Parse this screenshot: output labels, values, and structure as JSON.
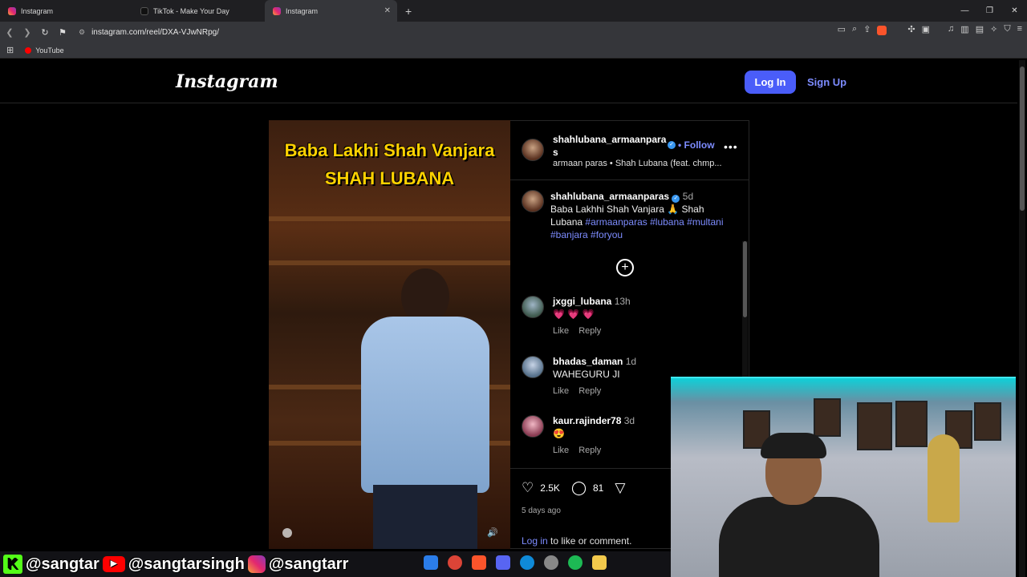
{
  "browser": {
    "tabs": [
      {
        "label": "Instagram",
        "icon": "instagram-icon"
      },
      {
        "label": "TikTok - Make Your Day",
        "icon": "tiktok-icon"
      },
      {
        "label": "Instagram",
        "icon": "instagram-icon"
      }
    ],
    "url": "instagram.com/reel/DXA-VJwNRpg/",
    "bookmark": "YouTube"
  },
  "header": {
    "logo": "Instagram",
    "login": "Log In",
    "signup": "Sign Up"
  },
  "video": {
    "caption_line1": "Baba Lakhi Shah Vanjara",
    "caption_line2": "SHAH LUBANA"
  },
  "post": {
    "username": "shahlubana_armaanparas",
    "follow": "Follow",
    "subline": "armaan paras • Shah Lubana (feat. chmp...",
    "caption_user": "shahlubana_armaanparas",
    "caption_time": "5d",
    "caption_text": "Baba Lakhhi Shah Vanjara 🙏 Shah Lubana ",
    "caption_tags": "#armaanparas #lubana #multani #banjara #foryou",
    "likes": "2.5K",
    "comments_count": "81",
    "posted": "5 days ago",
    "login_link": "Log in",
    "login_rest": " to like or comment."
  },
  "comments": [
    {
      "user": "jxggi_lubana",
      "time": "13h",
      "text": "💗 💗 💗",
      "like": "Like",
      "reply": "Reply"
    },
    {
      "user": "bhadas_daman",
      "time": "1d",
      "text": "WAHEGURU JI",
      "like": "Like",
      "reply": "Reply"
    },
    {
      "user": "kaur.rajinder78",
      "time": "3d",
      "text": "😍",
      "like": "Like",
      "reply": "Reply"
    }
  ],
  "overlay": {
    "kick": "@sangtar",
    "youtube": "@sangtarsingh",
    "instagram": "@sangtarr"
  },
  "colors": {
    "accent": "#4a5df9",
    "link": "#7d8cff"
  }
}
